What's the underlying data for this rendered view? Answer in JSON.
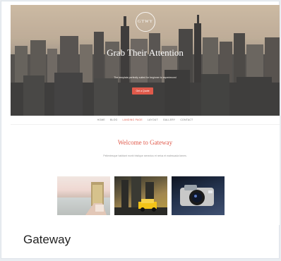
{
  "preview": {
    "logo_text": "GTWY",
    "hero_title": "Grab Their Attention",
    "hero_subtitle": "The template perfectly suited for beginner to experienced",
    "hero_button": "Get a Quote",
    "nav": [
      {
        "label": "HOME",
        "active": false
      },
      {
        "label": "BLOG",
        "active": false
      },
      {
        "label": "LANDING PAGE",
        "active": true
      },
      {
        "label": "LAYOUT",
        "active": false
      },
      {
        "label": "GALLERY",
        "active": false
      },
      {
        "label": "CONTACT",
        "active": false
      }
    ],
    "welcome_title": "Welcome to Gateway",
    "welcome_text": "Pellentesque habitant morbi tristique senectus et netus et malesuada fames."
  },
  "card": {
    "title": "Gateway"
  },
  "colors": {
    "accent": "#e05a4b",
    "text": "#222222",
    "card_bg": "#ffffff",
    "page_bg": "#e9edf1"
  }
}
